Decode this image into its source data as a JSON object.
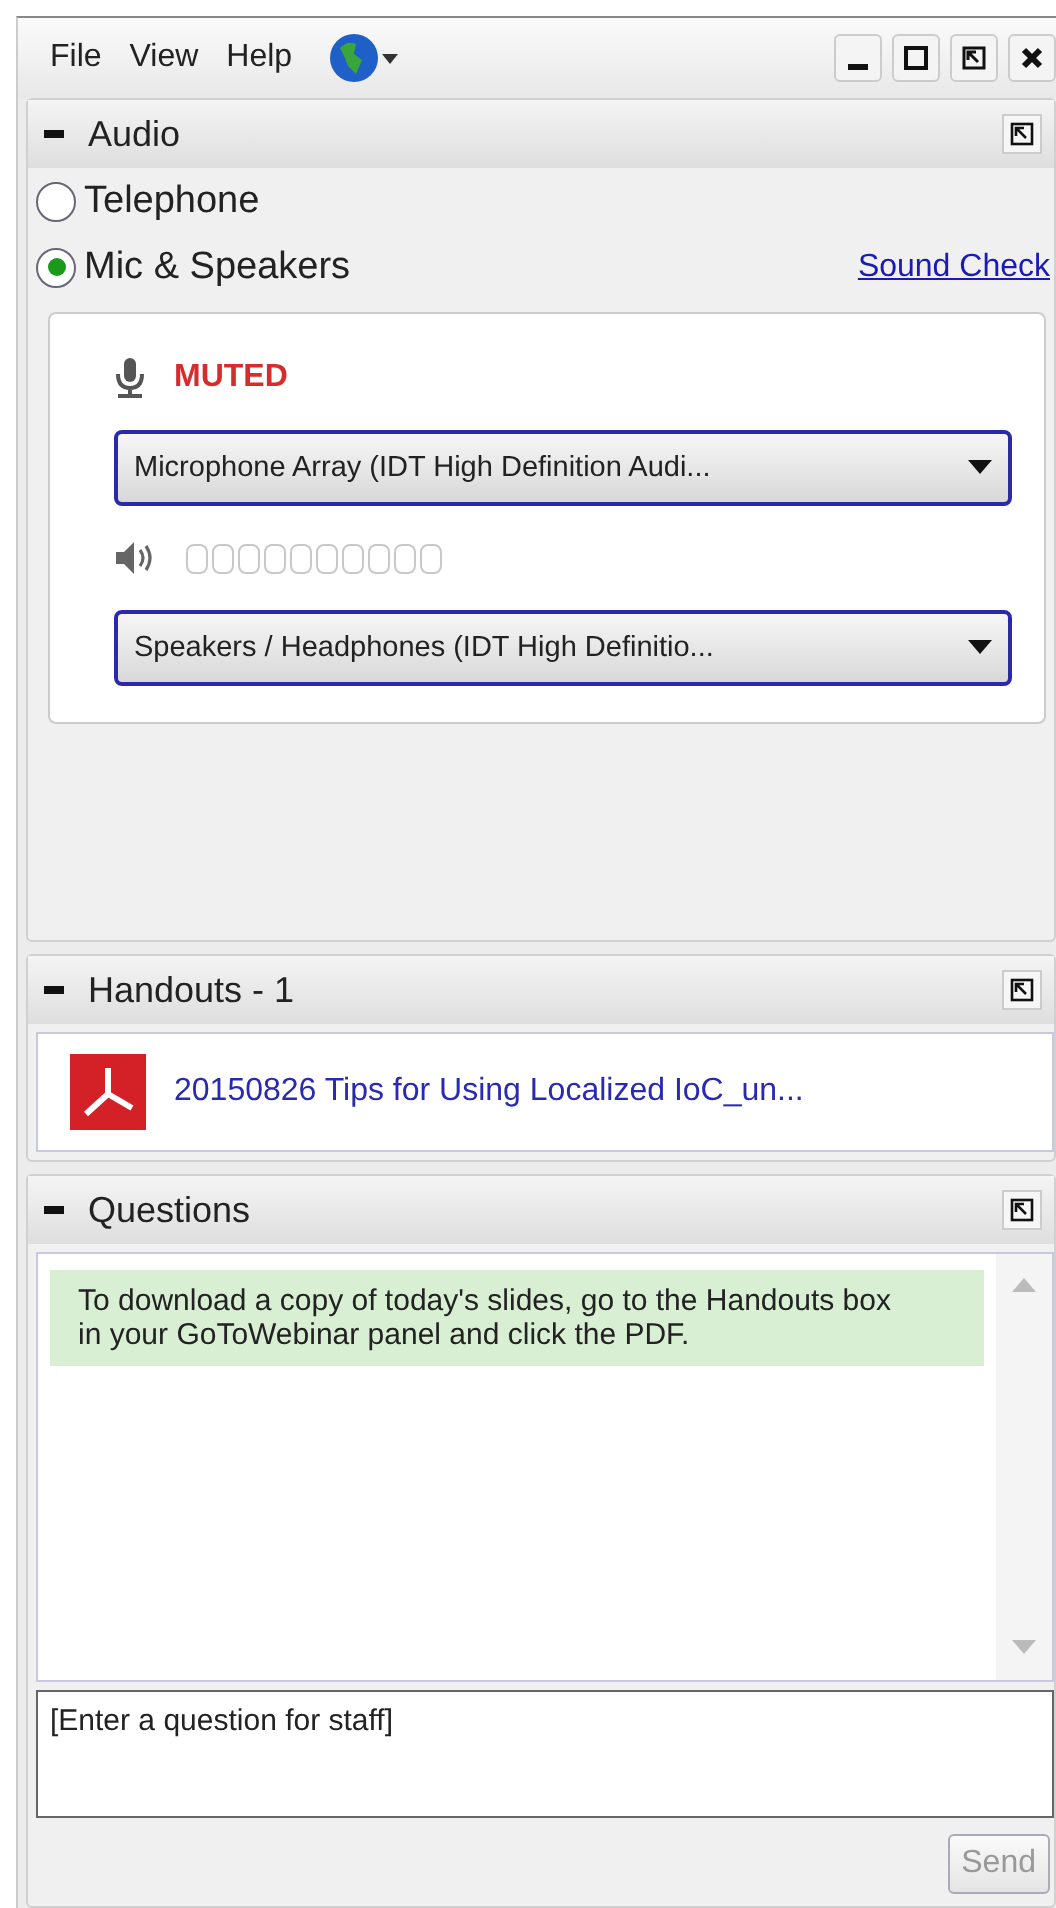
{
  "menu": [
    "File",
    "View",
    "Help"
  ],
  "audio": {
    "title": "Audio",
    "options": [
      {
        "label": "Telephone",
        "selected": false
      },
      {
        "label": "Mic & Speakers",
        "selected": true
      }
    ],
    "sound_check": "Sound Check",
    "mic_status": "MUTED",
    "microphone": "Microphone Array (IDT High Definition Audi...",
    "speaker_meter": {
      "level": 0
    },
    "speakers": "Speakers / Headphones (IDT High Definitio..."
  },
  "handouts": {
    "title": "Handouts - 1",
    "files": [
      "20150826 Tips for Using Localized IoC_un..."
    ]
  },
  "questions": {
    "title": "Questions",
    "messages": [
      "To download a copy of today's slides, go to the Handouts box in your GoToWebinar panel and click the PDF."
    ],
    "input": {
      "placeholder": "[Enter a question for staff]"
    },
    "send": {
      "label": "Send",
      "disabled": true
    }
  }
}
